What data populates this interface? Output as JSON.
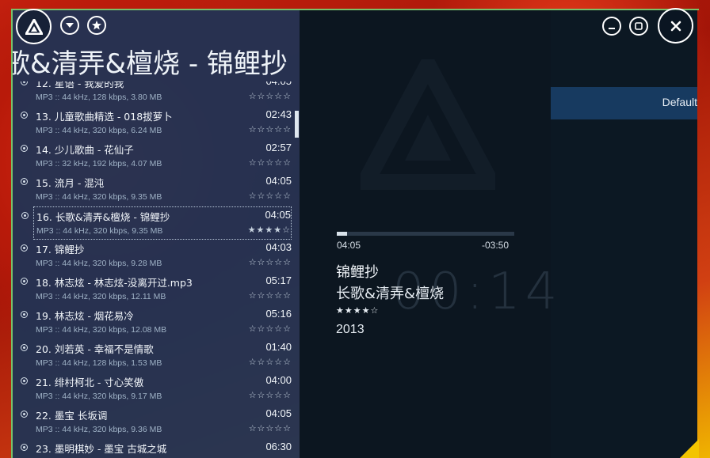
{
  "header": {
    "title_text": "歌&清弄&檀烧 - 锦鲤抄"
  },
  "right_panel": {
    "preset_label": "Default"
  },
  "tracks": [
    {
      "title": "12. 星语 - 我爱的我",
      "duration": "04:05",
      "meta": "MP3 :: 44 kHz, 128 kbps, 3.80 MB",
      "stars": "☆☆☆☆☆"
    },
    {
      "title": "13. 儿童歌曲精选 - 018拔萝卜",
      "duration": "02:43",
      "meta": "MP3 :: 44 kHz, 320 kbps, 6.24 MB",
      "stars": "☆☆☆☆☆"
    },
    {
      "title": "14. 少儿歌曲 - 花仙子",
      "duration": "02:57",
      "meta": "MP3 :: 32 kHz, 192 kbps, 4.07 MB",
      "stars": "☆☆☆☆☆"
    },
    {
      "title": "15. 流月 - 混沌",
      "duration": "04:05",
      "meta": "MP3 :: 44 kHz, 320 kbps, 9.35 MB",
      "stars": "☆☆☆☆☆"
    },
    {
      "title": "16. 长歌&清弄&檀烧 - 锦鲤抄",
      "duration": "04:05",
      "meta": "MP3 :: 44 kHz, 320 kbps, 9.35 MB",
      "stars": "★★★★☆",
      "selected": true
    },
    {
      "title": "17. 锦鲤抄",
      "duration": "04:03",
      "meta": "MP3 :: 44 kHz, 320 kbps, 9.28 MB",
      "stars": "☆☆☆☆☆"
    },
    {
      "title": "18. 林志炫 - 林志炫-没离开过.mp3",
      "duration": "05:17",
      "meta": "MP3 :: 44 kHz, 320 kbps, 12.11 MB",
      "stars": "☆☆☆☆☆"
    },
    {
      "title": "19. 林志炫 - 烟花易冷",
      "duration": "05:16",
      "meta": "MP3 :: 44 kHz, 320 kbps, 12.08 MB",
      "stars": "☆☆☆☆☆"
    },
    {
      "title": "20. 刘若英 - 幸福不是情歌",
      "duration": "01:40",
      "meta": "MP3 :: 44 kHz, 128 kbps, 1.53 MB",
      "stars": "☆☆☆☆☆"
    },
    {
      "title": "21. 绯村柯北 - 寸心笑傲",
      "duration": "04:00",
      "meta": "MP3 :: 44 kHz, 320 kbps, 9.17 MB",
      "stars": "☆☆☆☆☆"
    },
    {
      "title": "22. 墨宝 长坂调",
      "duration": "04:05",
      "meta": "MP3 :: 44 kHz, 320 kbps, 9.36 MB",
      "stars": "☆☆☆☆☆"
    },
    {
      "title": "23. 墨明棋妙 - 墨宝 古城之城",
      "duration": "06:30",
      "meta": "",
      "stars": ""
    }
  ],
  "now_playing": {
    "elapsed": "04:05",
    "remaining": "-03:50",
    "progress": 0.06,
    "title": "锦鲤抄",
    "artist": "长歌&清弄&檀烧",
    "rating": "★★★★☆",
    "year": "2013",
    "clock": "00:14"
  },
  "icons": {
    "logo": "aimp-triangle-logo",
    "dropdown": "chevron-down-icon",
    "favorite": "star-icon",
    "minimize": "minimize-icon",
    "maximize": "maximize-icon",
    "close": "close-icon"
  },
  "colors": {
    "playlist_bg": "#183458",
    "player_bg": "#0c1620",
    "accent_bar": "#173a60"
  }
}
